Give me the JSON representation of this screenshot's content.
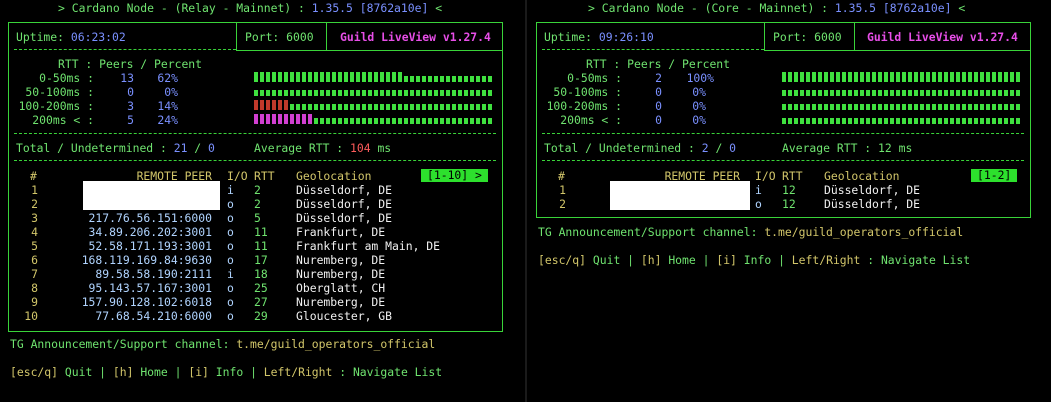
{
  "left": {
    "header": {
      "prefix": "> Cardano Node - (Relay - Mainnet) : ",
      "version": "1.35.5",
      "hash": "[8762a10e]",
      "suffix": " <"
    },
    "uptime_label": "Uptime:",
    "uptime": "06:23:02",
    "port_label": "Port:",
    "port": "6000",
    "liveview": "Guild LiveView v1.27.4",
    "rtt_header": "RTT : Peers / Percent",
    "rtt_rows": [
      {
        "label": "0-50ms :",
        "peers": "13",
        "pct": "62%",
        "fill": 0.62,
        "color": "#3fe03f"
      },
      {
        "label": "50-100ms :",
        "peers": "0",
        "pct": "0%",
        "fill": 0.0,
        "color": "#3fe03f"
      },
      {
        "label": "100-200ms :",
        "peers": "3",
        "pct": "14%",
        "fill": 0.14,
        "color": "#c0392b"
      },
      {
        "label": "200ms < :",
        "peers": "5",
        "pct": "24%",
        "fill": 0.24,
        "color": "#d13fd1"
      }
    ],
    "total_label": "Total / Undetermined :",
    "total": "21",
    "undetermined": "0",
    "avg_label": "Average RTT :",
    "avg": "104",
    "avg_unit": "ms",
    "table_headers": {
      "num": "#",
      "peer": "REMOTE PEER",
      "io": "I/O",
      "rtt": "RTT",
      "geo": "Geolocation"
    },
    "page_badge": "[1-10] >",
    "peers": [
      {
        "n": "1",
        "peer": "",
        "io": "i",
        "rtt": "2",
        "geo": "Düsseldorf, DE"
      },
      {
        "n": "2",
        "peer": "",
        "io": "o",
        "rtt": "2",
        "geo": "Düsseldorf, DE"
      },
      {
        "n": "3",
        "peer": "217.76.56.151:6000",
        "io": "o",
        "rtt": "5",
        "geo": "Düsseldorf, DE"
      },
      {
        "n": "4",
        "peer": "34.89.206.202:3001",
        "io": "o",
        "rtt": "11",
        "geo": "Frankfurt, DE"
      },
      {
        "n": "5",
        "peer": "52.58.171.193:3001",
        "io": "o",
        "rtt": "11",
        "geo": "Frankfurt am Main, DE"
      },
      {
        "n": "6",
        "peer": "168.119.169.84:9630",
        "io": "o",
        "rtt": "17",
        "geo": "Nuremberg, DE"
      },
      {
        "n": "7",
        "peer": "89.58.58.190:2111",
        "io": "i",
        "rtt": "18",
        "geo": "Nuremberg, DE"
      },
      {
        "n": "8",
        "peer": "95.143.57.167:3001",
        "io": "o",
        "rtt": "25",
        "geo": "Oberglatt, CH"
      },
      {
        "n": "9",
        "peer": "157.90.128.102:6018",
        "io": "o",
        "rtt": "27",
        "geo": "Nuremberg, DE"
      },
      {
        "n": "10",
        "peer": "77.68.54.210:6000",
        "io": "o",
        "rtt": "29",
        "geo": "Gloucester, GB"
      }
    ],
    "tg_label": "TG Announcement/Support channel:",
    "tg_link": "t.me/guild_operators_official",
    "nav": {
      "esc": "[esc/q]",
      "quit": "Quit",
      "h": "[h]",
      "home": "Home",
      "i": "[i]",
      "info": "Info",
      "lr": "Left/Right",
      "navigate": "Navigate List"
    }
  },
  "right": {
    "header": {
      "prefix": "> Cardano Node - (Core - Mainnet) : ",
      "version": "1.35.5",
      "hash": "[8762a10e]",
      "suffix": " <"
    },
    "uptime_label": "Uptime:",
    "uptime": "09:26:10",
    "port_label": "Port:",
    "port": "6000",
    "liveview": "Guild LiveView v1.27.4",
    "rtt_header": "RTT : Peers / Percent",
    "rtt_rows": [
      {
        "label": "0-50ms :",
        "peers": "2",
        "pct": "100%",
        "fill": 1.0,
        "color": "#3fe03f"
      },
      {
        "label": "50-100ms :",
        "peers": "0",
        "pct": "0%",
        "fill": 0.0,
        "color": "#3fe03f"
      },
      {
        "label": "100-200ms :",
        "peers": "0",
        "pct": "0%",
        "fill": 0.0,
        "color": "#3fe03f"
      },
      {
        "label": "200ms < :",
        "peers": "0",
        "pct": "0%",
        "fill": 0.0,
        "color": "#3fe03f"
      }
    ],
    "total_label": "Total / Undetermined :",
    "total": "2",
    "undetermined": "0",
    "avg_label": "Average RTT :",
    "avg": "12",
    "avg_unit": "ms",
    "table_headers": {
      "num": "#",
      "peer": "REMOTE PEER",
      "io": "I/O",
      "rtt": "RTT",
      "geo": "Geolocation"
    },
    "page_badge": "[1-2]",
    "peers": [
      {
        "n": "1",
        "peer": "",
        "io": "i",
        "rtt": "12",
        "geo": "Düsseldorf, DE"
      },
      {
        "n": "2",
        "peer": "",
        "io": "o",
        "rtt": "12",
        "geo": "Düsseldorf, DE"
      }
    ],
    "tg_label": "TG Announcement/Support channel:",
    "tg_link": "t.me/guild_operators_official",
    "nav": {
      "esc": "[esc/q]",
      "quit": "Quit",
      "h": "[h]",
      "home": "Home",
      "i": "[i]",
      "info": "Info",
      "lr": "Left/Right",
      "navigate": "Navigate List"
    }
  }
}
